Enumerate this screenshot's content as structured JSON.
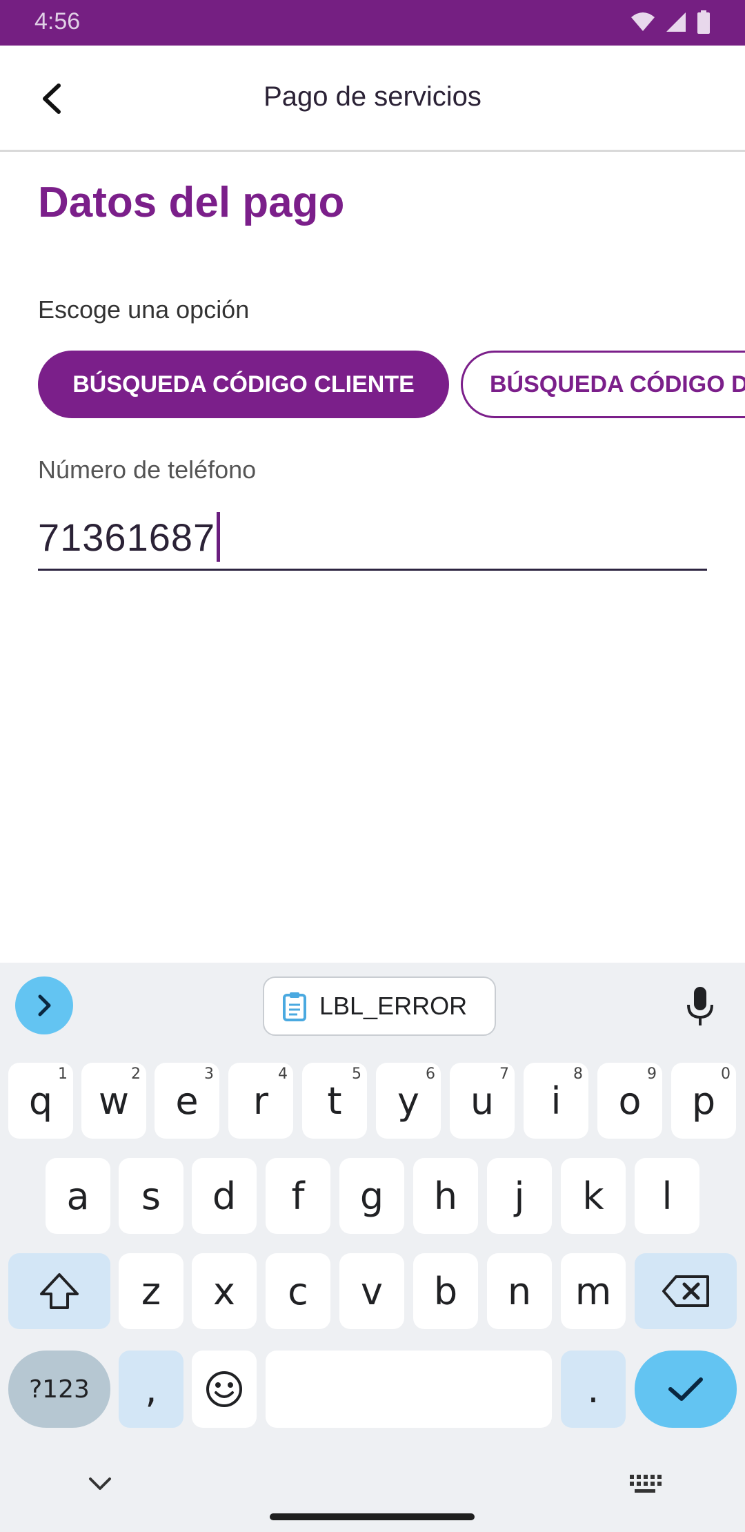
{
  "status_bar": {
    "time": "4:56",
    "icons": [
      "wifi-icon",
      "signal-icon",
      "battery-icon"
    ]
  },
  "app_bar": {
    "title": "Pago de servicios",
    "back_icon": "chevron-left-icon"
  },
  "form": {
    "section_title": "Datos del pago",
    "option_label": "Escoge una opción",
    "options": [
      {
        "label": "BÚSQUEDA CÓDIGO CLIENTE",
        "selected": true
      },
      {
        "label": "BÚSQUEDA CÓDIGO D",
        "selected": false
      }
    ],
    "phone_label": "Número de teléfono",
    "phone_value": "71361687"
  },
  "keyboard": {
    "clipboard_suggestion": "LBL_ERROR",
    "row1": [
      {
        "key": "q",
        "hint": "1"
      },
      {
        "key": "w",
        "hint": "2"
      },
      {
        "key": "e",
        "hint": "3"
      },
      {
        "key": "r",
        "hint": "4"
      },
      {
        "key": "t",
        "hint": "5"
      },
      {
        "key": "y",
        "hint": "6"
      },
      {
        "key": "u",
        "hint": "7"
      },
      {
        "key": "i",
        "hint": "8"
      },
      {
        "key": "o",
        "hint": "9"
      },
      {
        "key": "p",
        "hint": "0"
      }
    ],
    "row2": [
      "a",
      "s",
      "d",
      "f",
      "g",
      "h",
      "j",
      "k",
      "l"
    ],
    "row3": [
      "z",
      "x",
      "c",
      "v",
      "b",
      "n",
      "m"
    ],
    "symbols_label": "?123",
    "comma": ",",
    "period": "."
  },
  "colors": {
    "brand": "#7b1f8a",
    "status_bar": "#751f82",
    "keyboard_accent": "#63c4f2",
    "keyboard_background": "#eef0f3"
  }
}
